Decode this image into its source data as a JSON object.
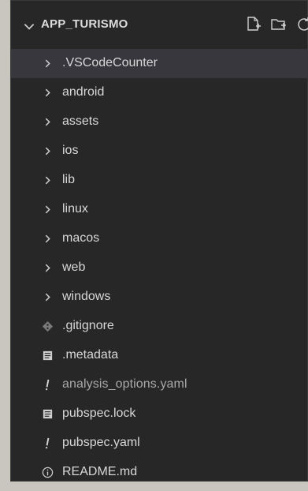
{
  "explorer": {
    "title": "APP_TURISMO",
    "actions": [
      {
        "icon": "new-file-icon"
      },
      {
        "icon": "new-folder-icon"
      },
      {
        "icon": "refresh-icon"
      }
    ]
  },
  "tree": {
    "folders": [
      {
        "label": ".VSCodeCounter"
      },
      {
        "label": "android"
      },
      {
        "label": "assets"
      },
      {
        "label": "ios"
      },
      {
        "label": "lib"
      },
      {
        "label": "linux"
      },
      {
        "label": "macos"
      },
      {
        "label": "web"
      },
      {
        "label": "windows"
      }
    ],
    "files": [
      {
        "label": ".gitignore",
        "icon": "git-icon"
      },
      {
        "label": ".metadata",
        "icon": "metadata-icon"
      },
      {
        "label": "analysis_options.yaml",
        "icon": "yaml-icon"
      },
      {
        "label": "pubspec.lock",
        "icon": "lock-file-icon"
      },
      {
        "label": "pubspec.yaml",
        "icon": "yaml-icon"
      },
      {
        "label": "README.md",
        "icon": "info-icon"
      }
    ]
  },
  "colors": {
    "panel_bg": "#272727",
    "selected_row": "#37373d",
    "text": "#d8d8d8",
    "page_bg": "#c9c6c0"
  }
}
